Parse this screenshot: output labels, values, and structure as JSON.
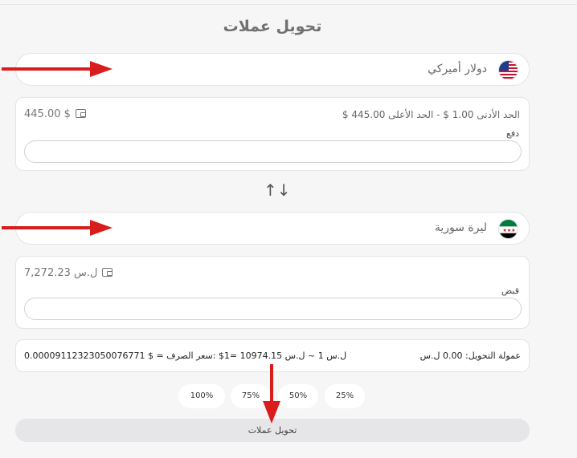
{
  "page": {
    "title": "تحويل عملات"
  },
  "from": {
    "currency_name": "دولار أميركي",
    "flag": "us-flag-icon",
    "limits_text": "الحد الأدنى 1.00 $   -   الحد الأعلى 445.00 $",
    "balance": "445.00 $",
    "field_label": "دفع",
    "amount_value": ""
  },
  "to": {
    "currency_name": "ليرة سورية",
    "flag": "syria-flag-icon",
    "balance": "7,272.23 ل.س",
    "field_label": "قبض",
    "amount_value": ""
  },
  "swap_icon": "↑↓",
  "info": {
    "fee": "عمولة التحويل: 0.00 ل.س",
    "rate": "0.0000911232305007677​1 $ =ل.س 1 ~ ل.س 10974.15 =1$ :سعر الصرف"
  },
  "percent_buttons": [
    "100%",
    "75%",
    "50%",
    "25%"
  ],
  "submit_label": "تحويل عملات",
  "colors": {
    "accent_red": "#d91c1c",
    "background": "#f6f6f7"
  }
}
